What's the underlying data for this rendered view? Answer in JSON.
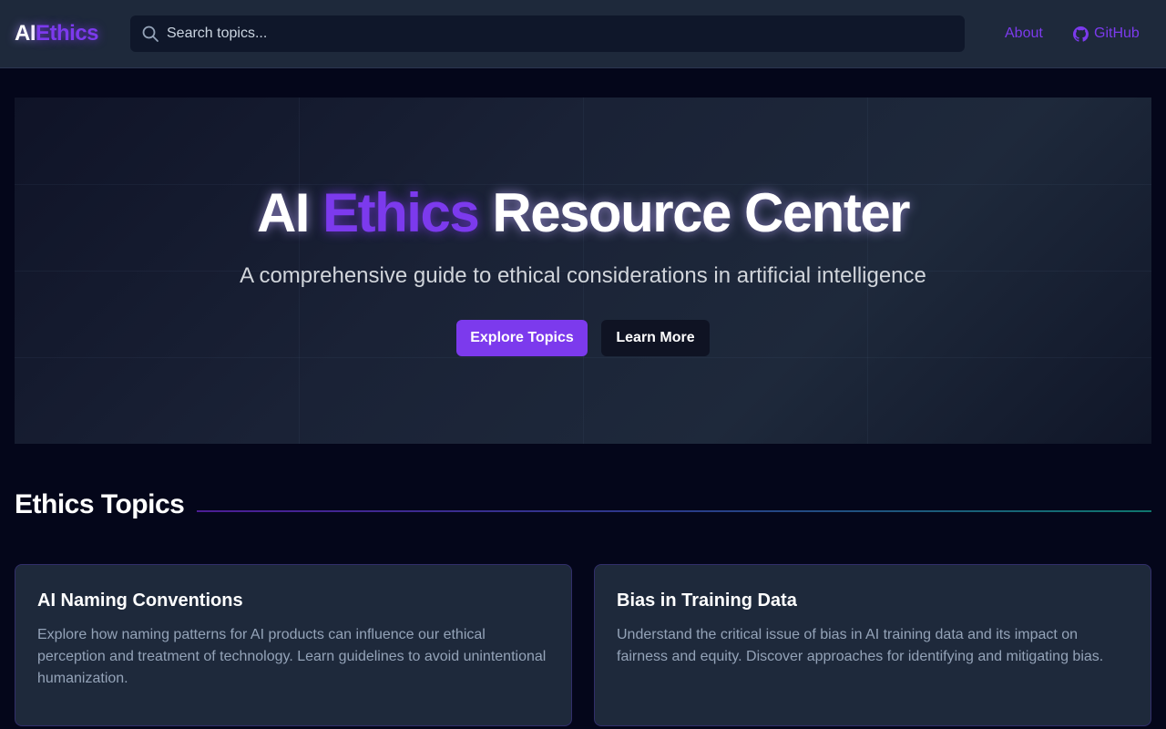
{
  "header": {
    "logo_part1": "AI",
    "logo_part2": "Ethics",
    "search_placeholder": "Search topics...",
    "search_icon": "search-icon",
    "nav": {
      "about": "About",
      "github": "GitHub",
      "github_icon": "github-icon"
    }
  },
  "hero": {
    "title_part1": "AI",
    "title_part2": "Ethics",
    "title_part3": "Resource Center",
    "subtitle": "A comprehensive guide to ethical considerations in artificial intelligence",
    "primary_button": "Explore Topics",
    "secondary_button": "Learn More"
  },
  "topics": {
    "heading": "Ethics Topics",
    "cards": [
      {
        "title": "AI Naming Conventions",
        "description": "Explore how naming patterns for AI products can influence our ethical perception and treatment of technology. Learn guidelines to avoid unintentional humanization."
      },
      {
        "title": "Bias in Training Data",
        "description": "Understand the critical issue of bias in AI training data and its impact on fairness and equity. Discover approaches for identifying and mitigating bias."
      }
    ]
  },
  "colors": {
    "accent": "#7c3aed",
    "background": "#04061a",
    "surface": "#1e293b"
  }
}
